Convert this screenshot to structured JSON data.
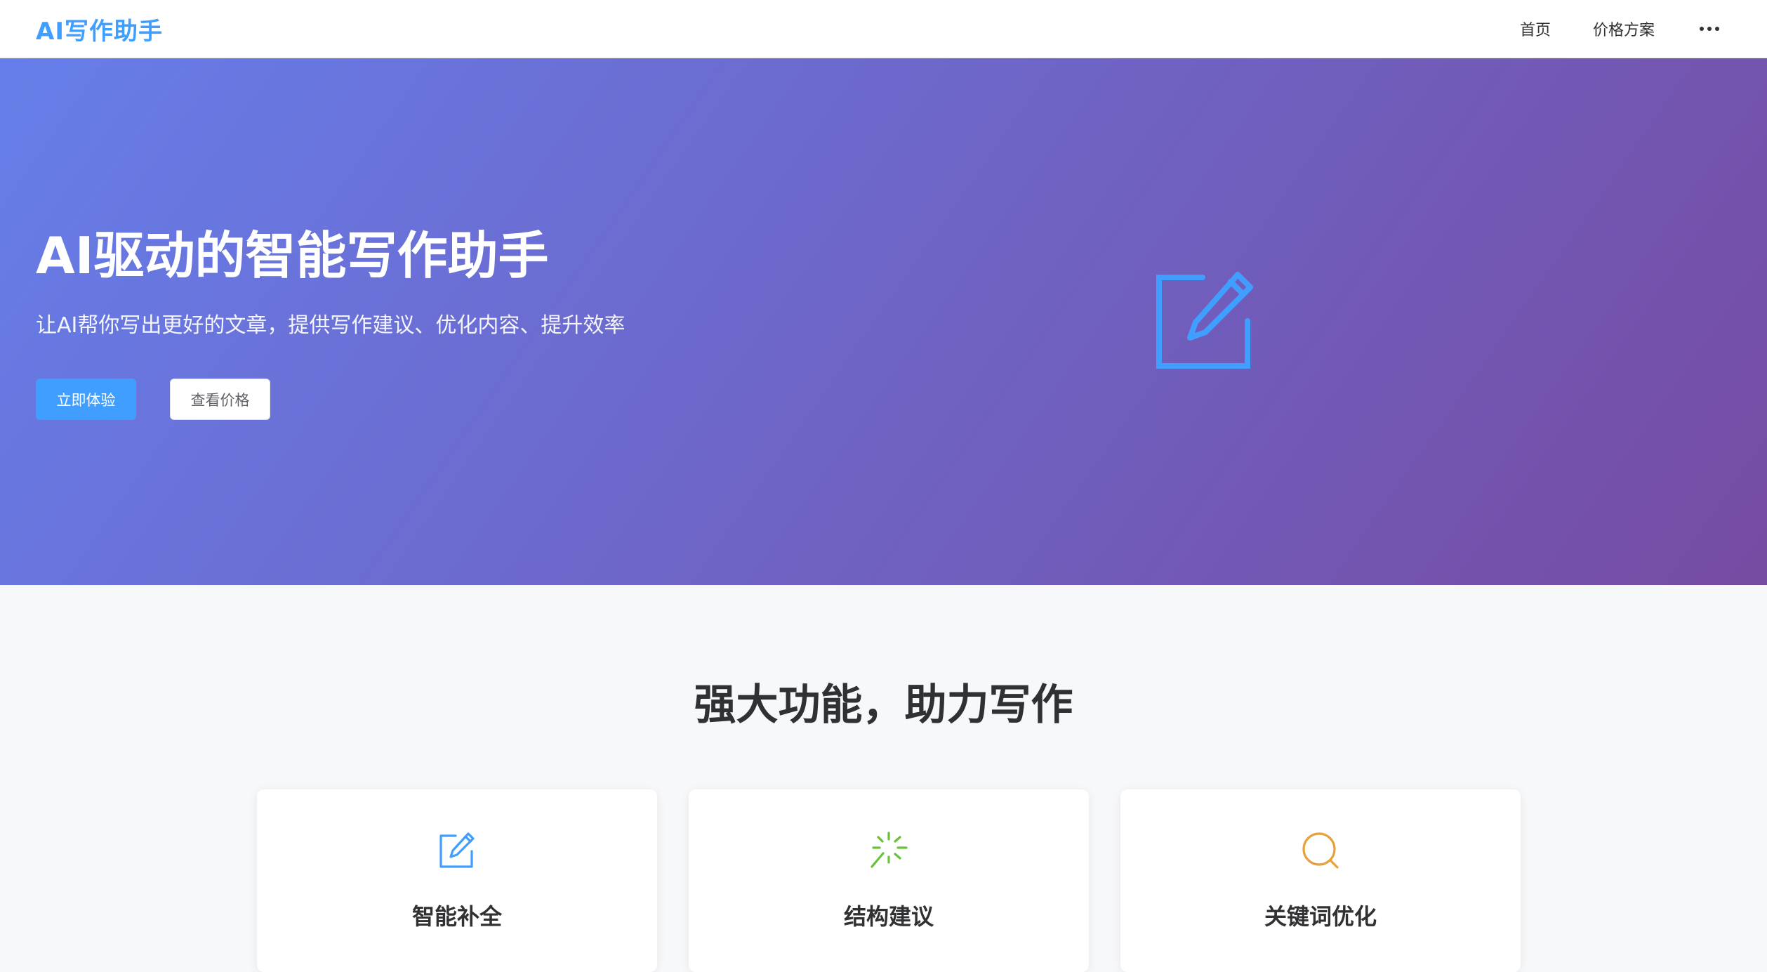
{
  "header": {
    "logo": "AI写作助手",
    "nav": {
      "home": "首页",
      "pricing": "价格方案",
      "more_icon": "more-dots-icon"
    }
  },
  "hero": {
    "title": "AI驱动的智能写作助手",
    "subtitle": "让AI帮你写出更好的文章，提供写作建议、优化内容、提升效率",
    "primary_button": "立即体验",
    "secondary_button": "查看价格",
    "illustration_icon": "edit-icon",
    "gradient": [
      "#667eea",
      "#764ba2"
    ]
  },
  "features": {
    "title": "强大功能，助力写作",
    "cards": [
      {
        "title": "智能补全",
        "icon": "edit-icon",
        "color": "#409eff"
      },
      {
        "title": "结构建议",
        "icon": "magic-stick-icon",
        "color": "#67c23a"
      },
      {
        "title": "关键词优化",
        "icon": "search-icon",
        "color": "#e6a23c"
      }
    ]
  },
  "colors": {
    "accent": "#409eff",
    "text": "#303133",
    "background": "#f7f8fa"
  }
}
